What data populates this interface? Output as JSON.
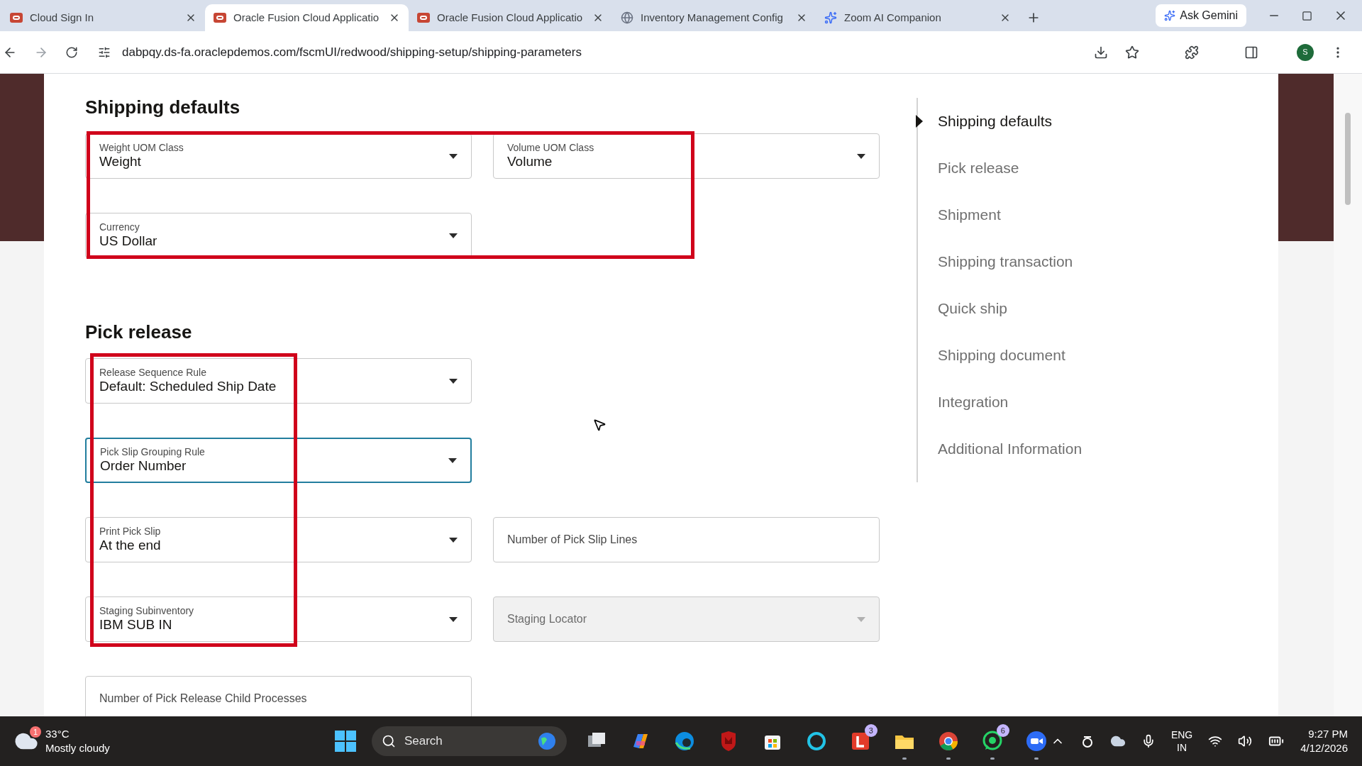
{
  "browser": {
    "tabs": [
      {
        "title": "Cloud Sign In",
        "kind": "oracle",
        "selected": false
      },
      {
        "title": "Oracle Fusion Cloud Applicatio",
        "kind": "oracle",
        "selected": true
      },
      {
        "title": "Oracle Fusion Cloud Applicatio",
        "kind": "oracle",
        "selected": false
      },
      {
        "title": "Inventory Management Config",
        "kind": "globe",
        "selected": false
      },
      {
        "title": "Zoom AI Companion",
        "kind": "sparkle",
        "selected": false
      }
    ],
    "gemini_button": "Ask Gemini",
    "url": "dabpqy.ds-fa.oraclepdemos.com/fscmUI/redwood/shipping-setup/shipping-parameters",
    "profile_initial": "S"
  },
  "sections": [
    {
      "title": "Shipping defaults",
      "rows": [
        [
          {
            "label": "Weight UOM Class",
            "value": "Weight",
            "kind": "select",
            "disabled": false,
            "focused": false
          },
          {
            "label": "Volume UOM Class",
            "value": "Volume",
            "kind": "select",
            "disabled": false,
            "focused": false
          }
        ],
        [
          {
            "label": "Currency",
            "value": "US Dollar",
            "kind": "select",
            "disabled": false,
            "focused": false
          }
        ]
      ]
    },
    {
      "title": "Pick release",
      "rows": [
        [
          {
            "label": "Release Sequence Rule",
            "value": "Default: Scheduled Ship Date",
            "kind": "select",
            "disabled": false,
            "focused": false
          }
        ],
        [
          {
            "label": "Pick Slip Grouping Rule",
            "value": "Order Number",
            "kind": "select",
            "disabled": false,
            "focused": true
          }
        ],
        [
          {
            "label": "Print Pick Slip",
            "value": "At the end",
            "kind": "select",
            "disabled": false,
            "focused": false
          },
          {
            "label": "Number of Pick Slip Lines",
            "kind": "text",
            "disabled": false,
            "focused": false
          }
        ],
        [
          {
            "label": "Staging Subinventory",
            "value": "IBM SUB IN",
            "kind": "select",
            "disabled": false,
            "focused": false
          },
          {
            "label": "Staging Locator",
            "kind": "select",
            "disabled": true,
            "focused": false
          }
        ],
        [
          {
            "label": "Number of Pick Release Child Processes",
            "kind": "text",
            "disabled": false,
            "focused": false
          }
        ]
      ]
    }
  ],
  "nav": [
    {
      "label": "Shipping defaults",
      "selected": true
    },
    {
      "label": "Pick release",
      "selected": false
    },
    {
      "label": "Shipment",
      "selected": false
    },
    {
      "label": "Shipping transaction",
      "selected": false
    },
    {
      "label": "Quick ship",
      "selected": false
    },
    {
      "label": "Shipping document",
      "selected": false
    },
    {
      "label": "Integration",
      "selected": false
    },
    {
      "label": "Additional Information",
      "selected": false
    }
  ],
  "taskbar": {
    "weather": {
      "badge": "1",
      "temperature": "33°C",
      "condition": "Mostly cloudy"
    },
    "search": "Search",
    "apps": [
      {
        "kind": "taskview",
        "running": false
      },
      {
        "kind": "copilot",
        "running": false
      },
      {
        "kind": "edge",
        "running": false
      },
      {
        "kind": "shield",
        "running": false
      },
      {
        "kind": "store",
        "running": false
      },
      {
        "kind": "ring",
        "running": false
      },
      {
        "kind": "letter",
        "badge": "3",
        "running": false
      },
      {
        "kind": "folder",
        "running": true
      },
      {
        "kind": "chrome",
        "running": true
      },
      {
        "kind": "whatsapp",
        "badge": "6",
        "running": true
      },
      {
        "kind": "zoom",
        "running": true
      }
    ],
    "language": "ENG",
    "region": "IN",
    "time": "9:27 PM",
    "date": "4/12/2026"
  }
}
